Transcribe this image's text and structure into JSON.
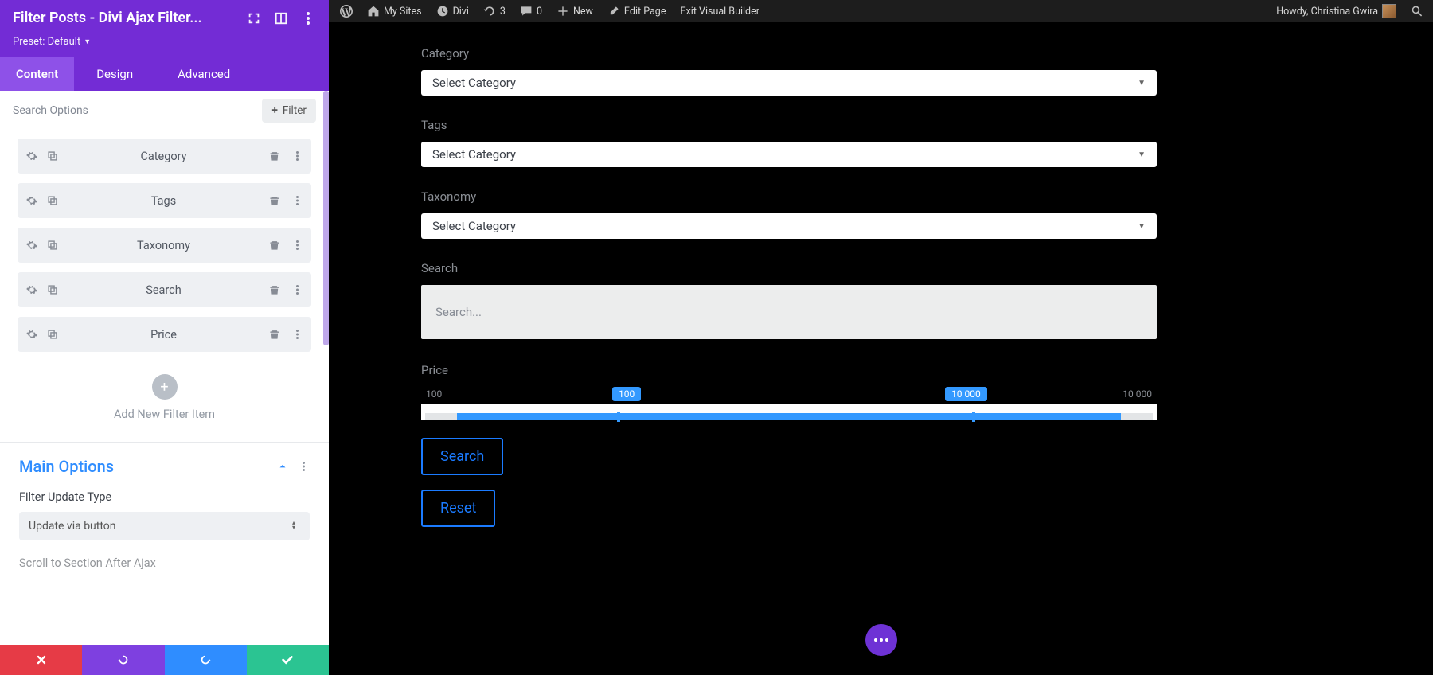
{
  "adminbar": {
    "mysites": "My Sites",
    "divi": "Divi",
    "refresh_count": "3",
    "comment_count": "0",
    "new": "New",
    "edit_page": "Edit Page",
    "exit_vb": "Exit Visual Builder",
    "howdy": "Howdy, Christina Gwira"
  },
  "panel": {
    "title": "Filter Posts - Divi Ajax Filter...",
    "preset_label": "Preset: Default",
    "tabs": {
      "content": "Content",
      "design": "Design",
      "advanced": "Advanced"
    },
    "search_options": "Search Options",
    "add_filter": "Filter",
    "filters": [
      {
        "label": "Category"
      },
      {
        "label": "Tags"
      },
      {
        "label": "Taxonomy"
      },
      {
        "label": "Search"
      },
      {
        "label": "Price"
      }
    ],
    "add_new_label": "Add New Filter Item",
    "main_options_title": "Main Options",
    "filter_update_type_label": "Filter Update Type",
    "filter_update_type_value": "Update via button",
    "scroll_label": "Scroll to Section After Ajax"
  },
  "preview": {
    "category_label": "Category",
    "category_value": "Select Category",
    "tags_label": "Tags",
    "tags_value": "Select Category",
    "taxonomy_label": "Taxonomy",
    "taxonomy_value": "Select Category",
    "search_label": "Search",
    "search_placeholder": "Search...",
    "price_label": "Price",
    "price_min": "100",
    "price_max": "10 000",
    "price_lo": "100",
    "price_hi": "10 000",
    "search_btn": "Search",
    "reset_btn": "Reset"
  }
}
